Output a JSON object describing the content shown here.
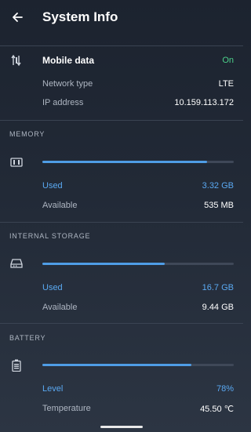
{
  "header": {
    "title": "System Info"
  },
  "network": {
    "mobile_data_label": "Mobile data",
    "mobile_data_status": "On",
    "network_type_label": "Network type",
    "network_type_value": "LTE",
    "ip_label": "IP address",
    "ip_value": "10.159.113.172"
  },
  "memory": {
    "header": "MEMORY",
    "usage_fraction": 0.86,
    "used_label": "Used",
    "used_value": "3.32 GB",
    "available_label": "Available",
    "available_value": "535 MB"
  },
  "storage": {
    "header": "INTERNAL STORAGE",
    "usage_fraction": 0.64,
    "used_label": "Used",
    "used_value": "16.7 GB",
    "available_label": "Available",
    "available_value": "9.44 GB"
  },
  "battery": {
    "header": "BATTERY",
    "level_fraction": 0.78,
    "level_label": "Level",
    "level_value": "78%",
    "temperature_label": "Temperature",
    "temperature_value": "45.50 ℃"
  },
  "icons": [
    "back-arrow-icon",
    "mobile-data-icon",
    "memory-icon",
    "storage-icon",
    "battery-icon"
  ],
  "colors": {
    "accent_blue": "#5aa9f2",
    "bar_fill": "#4f9de6",
    "status_green": "#4cd08a",
    "background": "#222a37"
  }
}
